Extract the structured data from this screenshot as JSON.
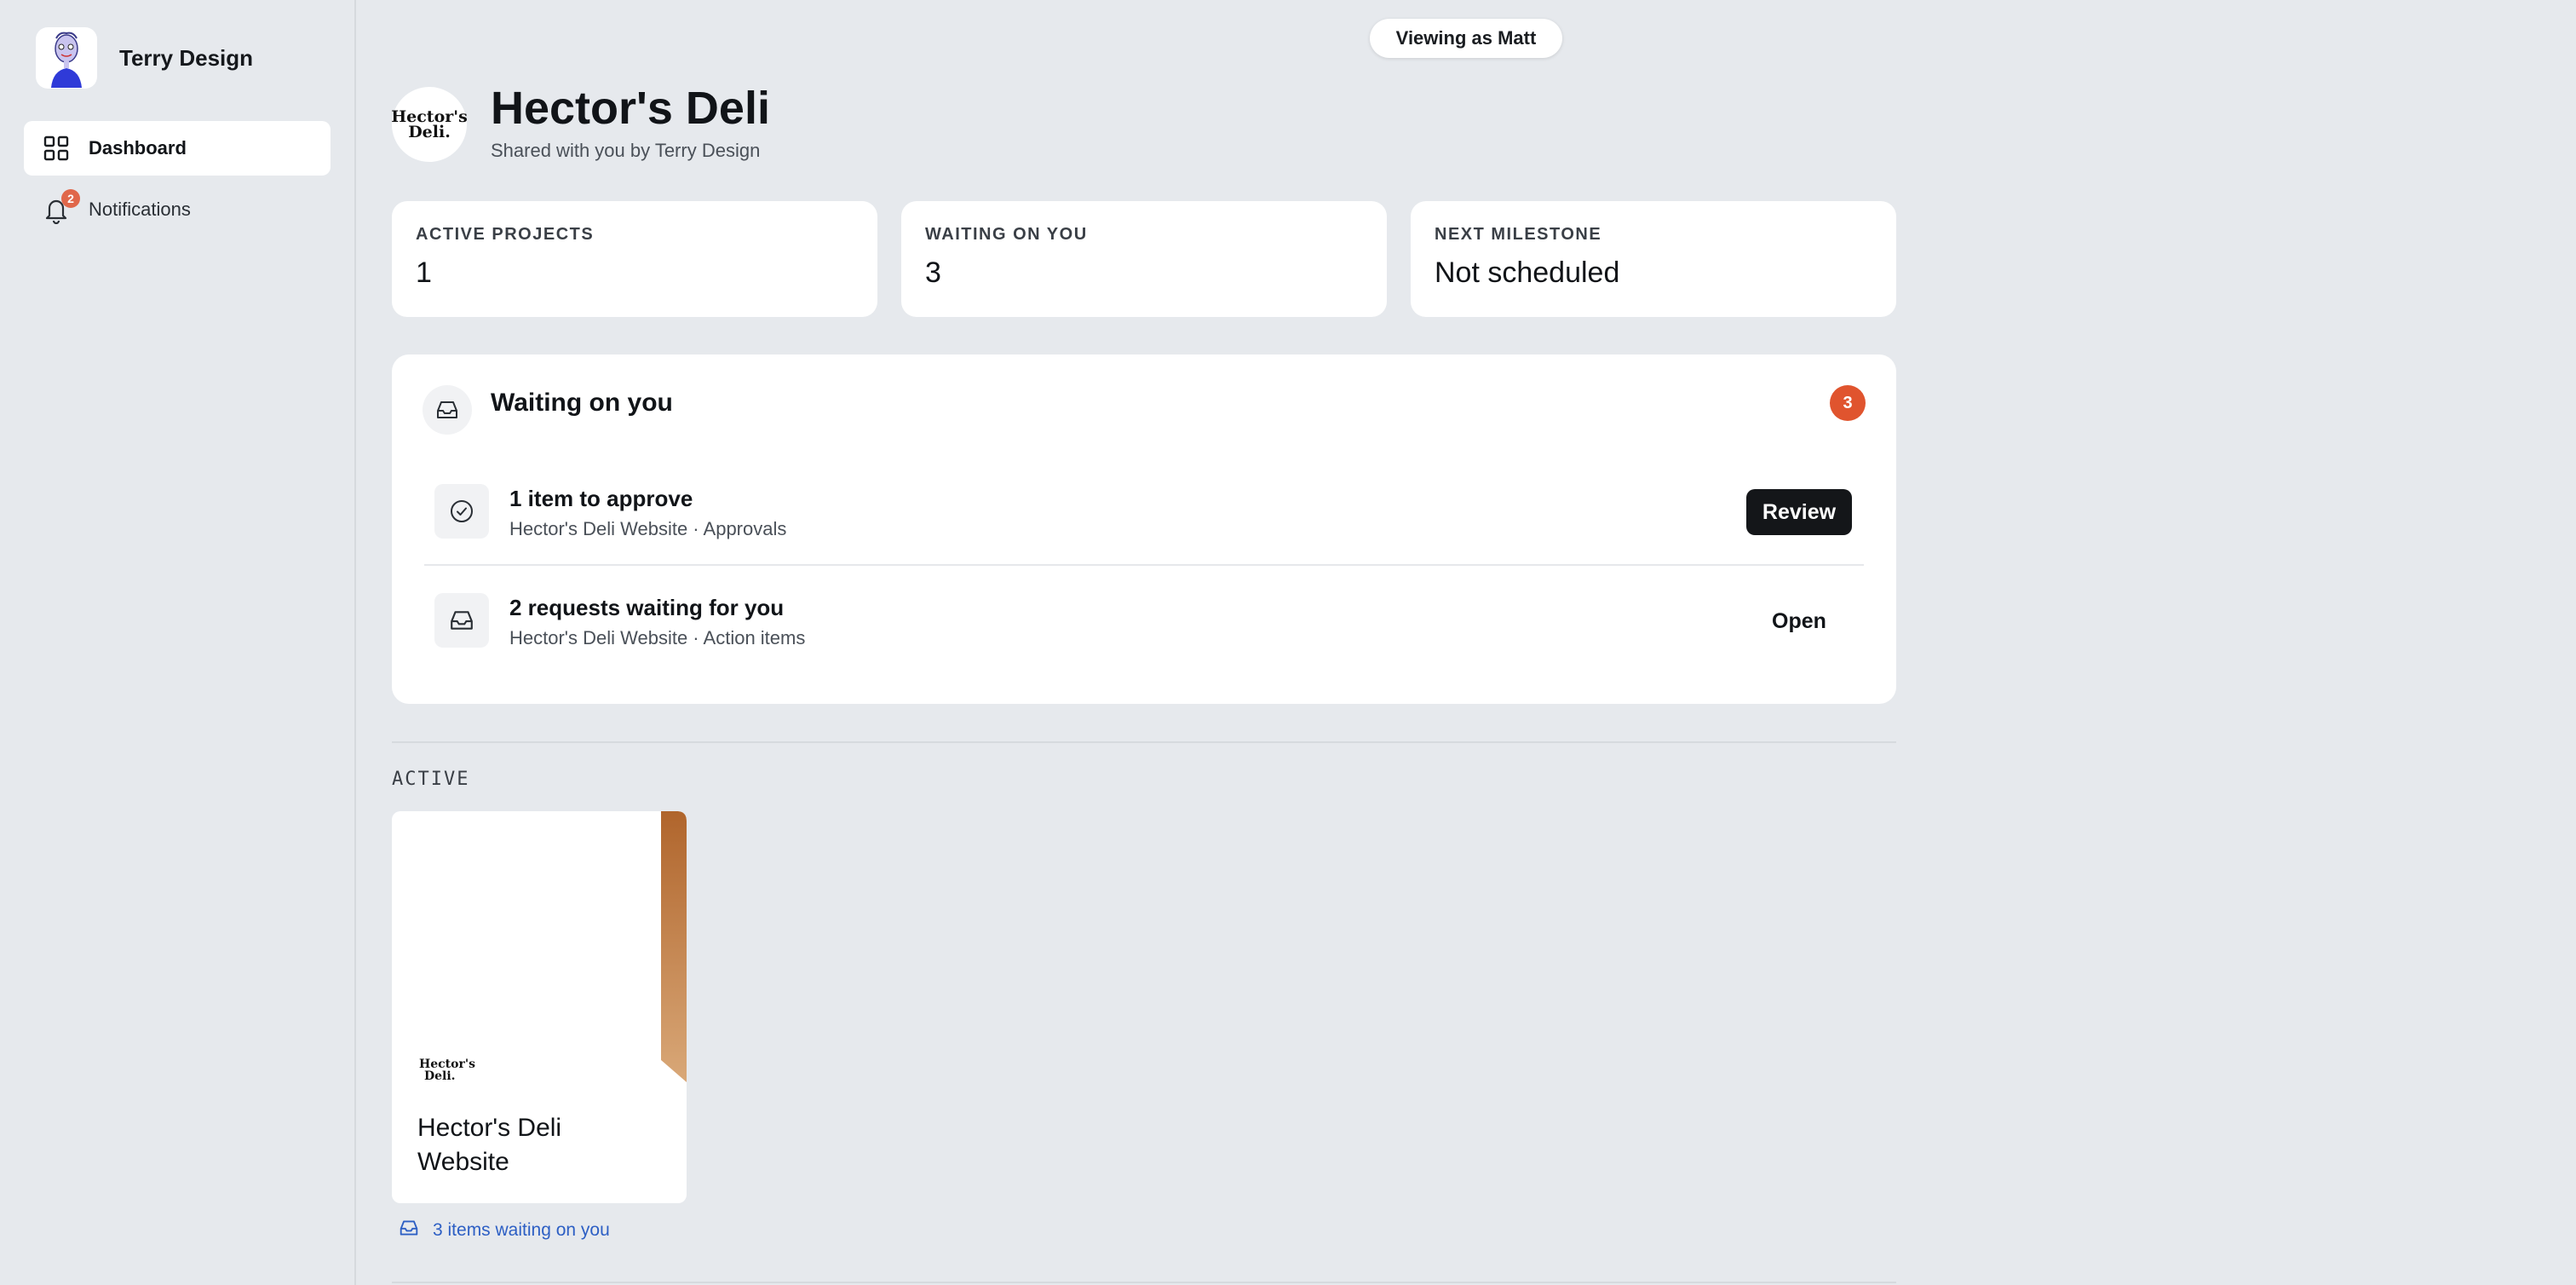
{
  "sidebar": {
    "brand_name": "Terry Design",
    "items": [
      {
        "label": "Dashboard",
        "icon": "grid-icon",
        "active": true
      },
      {
        "label": "Notifications",
        "icon": "bell-icon",
        "active": false,
        "badge": "2"
      }
    ]
  },
  "topbar": {
    "viewing_as": "Viewing as Matt"
  },
  "header": {
    "logo_line1": "Hector's",
    "logo_line2": "Deli.",
    "title": "Hector's Deli",
    "subtitle": "Shared with you by Terry Design"
  },
  "stats": [
    {
      "label": "ACTIVE PROJECTS",
      "value": "1"
    },
    {
      "label": "WAITING ON YOU",
      "value": "3"
    },
    {
      "label": "NEXT MILESTONE",
      "value": "Not scheduled"
    }
  ],
  "waiting": {
    "title": "Waiting on you",
    "count": "3",
    "rows": [
      {
        "title": "1 item to approve",
        "subtitle": "Hector's Deli Website · Approvals",
        "action": "Review",
        "icon": "check-circle-icon"
      },
      {
        "title": "2 requests waiting for you",
        "subtitle": "Hector's Deli Website · Action items",
        "action": "Open",
        "icon": "inbox-icon"
      }
    ]
  },
  "active_section": {
    "label": "ACTIVE",
    "projects": [
      {
        "logo_line1": "Hector's",
        "logo_line2": "Deli.",
        "name": "Hector's Deli Website",
        "waiting_text": "3 items waiting on you",
        "accent_color": "#c07a3e"
      }
    ]
  },
  "colors": {
    "background": "#e6e9ed",
    "badge_orange": "#e0542e",
    "link_blue": "#2d5fc4",
    "button_dark": "#141619"
  }
}
